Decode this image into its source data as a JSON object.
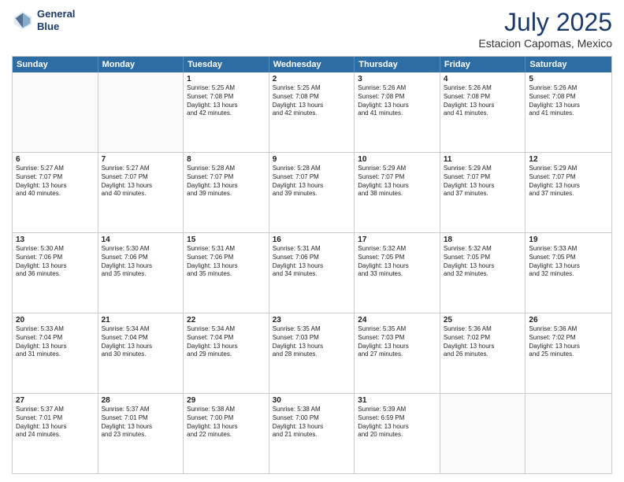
{
  "header": {
    "logo_line1": "General",
    "logo_line2": "Blue",
    "month_year": "July 2025",
    "location": "Estacion Capomas, Mexico"
  },
  "weekdays": [
    "Sunday",
    "Monday",
    "Tuesday",
    "Wednesday",
    "Thursday",
    "Friday",
    "Saturday"
  ],
  "rows": [
    [
      {
        "day": "",
        "text": ""
      },
      {
        "day": "",
        "text": ""
      },
      {
        "day": "1",
        "text": "Sunrise: 5:25 AM\nSunset: 7:08 PM\nDaylight: 13 hours\nand 42 minutes."
      },
      {
        "day": "2",
        "text": "Sunrise: 5:25 AM\nSunset: 7:08 PM\nDaylight: 13 hours\nand 42 minutes."
      },
      {
        "day": "3",
        "text": "Sunrise: 5:26 AM\nSunset: 7:08 PM\nDaylight: 13 hours\nand 41 minutes."
      },
      {
        "day": "4",
        "text": "Sunrise: 5:26 AM\nSunset: 7:08 PM\nDaylight: 13 hours\nand 41 minutes."
      },
      {
        "day": "5",
        "text": "Sunrise: 5:26 AM\nSunset: 7:08 PM\nDaylight: 13 hours\nand 41 minutes."
      }
    ],
    [
      {
        "day": "6",
        "text": "Sunrise: 5:27 AM\nSunset: 7:07 PM\nDaylight: 13 hours\nand 40 minutes."
      },
      {
        "day": "7",
        "text": "Sunrise: 5:27 AM\nSunset: 7:07 PM\nDaylight: 13 hours\nand 40 minutes."
      },
      {
        "day": "8",
        "text": "Sunrise: 5:28 AM\nSunset: 7:07 PM\nDaylight: 13 hours\nand 39 minutes."
      },
      {
        "day": "9",
        "text": "Sunrise: 5:28 AM\nSunset: 7:07 PM\nDaylight: 13 hours\nand 39 minutes."
      },
      {
        "day": "10",
        "text": "Sunrise: 5:29 AM\nSunset: 7:07 PM\nDaylight: 13 hours\nand 38 minutes."
      },
      {
        "day": "11",
        "text": "Sunrise: 5:29 AM\nSunset: 7:07 PM\nDaylight: 13 hours\nand 37 minutes."
      },
      {
        "day": "12",
        "text": "Sunrise: 5:29 AM\nSunset: 7:07 PM\nDaylight: 13 hours\nand 37 minutes."
      }
    ],
    [
      {
        "day": "13",
        "text": "Sunrise: 5:30 AM\nSunset: 7:06 PM\nDaylight: 13 hours\nand 36 minutes."
      },
      {
        "day": "14",
        "text": "Sunrise: 5:30 AM\nSunset: 7:06 PM\nDaylight: 13 hours\nand 35 minutes."
      },
      {
        "day": "15",
        "text": "Sunrise: 5:31 AM\nSunset: 7:06 PM\nDaylight: 13 hours\nand 35 minutes."
      },
      {
        "day": "16",
        "text": "Sunrise: 5:31 AM\nSunset: 7:06 PM\nDaylight: 13 hours\nand 34 minutes."
      },
      {
        "day": "17",
        "text": "Sunrise: 5:32 AM\nSunset: 7:05 PM\nDaylight: 13 hours\nand 33 minutes."
      },
      {
        "day": "18",
        "text": "Sunrise: 5:32 AM\nSunset: 7:05 PM\nDaylight: 13 hours\nand 32 minutes."
      },
      {
        "day": "19",
        "text": "Sunrise: 5:33 AM\nSunset: 7:05 PM\nDaylight: 13 hours\nand 32 minutes."
      }
    ],
    [
      {
        "day": "20",
        "text": "Sunrise: 5:33 AM\nSunset: 7:04 PM\nDaylight: 13 hours\nand 31 minutes."
      },
      {
        "day": "21",
        "text": "Sunrise: 5:34 AM\nSunset: 7:04 PM\nDaylight: 13 hours\nand 30 minutes."
      },
      {
        "day": "22",
        "text": "Sunrise: 5:34 AM\nSunset: 7:04 PM\nDaylight: 13 hours\nand 29 minutes."
      },
      {
        "day": "23",
        "text": "Sunrise: 5:35 AM\nSunset: 7:03 PM\nDaylight: 13 hours\nand 28 minutes."
      },
      {
        "day": "24",
        "text": "Sunrise: 5:35 AM\nSunset: 7:03 PM\nDaylight: 13 hours\nand 27 minutes."
      },
      {
        "day": "25",
        "text": "Sunrise: 5:36 AM\nSunset: 7:02 PM\nDaylight: 13 hours\nand 26 minutes."
      },
      {
        "day": "26",
        "text": "Sunrise: 5:36 AM\nSunset: 7:02 PM\nDaylight: 13 hours\nand 25 minutes."
      }
    ],
    [
      {
        "day": "27",
        "text": "Sunrise: 5:37 AM\nSunset: 7:01 PM\nDaylight: 13 hours\nand 24 minutes."
      },
      {
        "day": "28",
        "text": "Sunrise: 5:37 AM\nSunset: 7:01 PM\nDaylight: 13 hours\nand 23 minutes."
      },
      {
        "day": "29",
        "text": "Sunrise: 5:38 AM\nSunset: 7:00 PM\nDaylight: 13 hours\nand 22 minutes."
      },
      {
        "day": "30",
        "text": "Sunrise: 5:38 AM\nSunset: 7:00 PM\nDaylight: 13 hours\nand 21 minutes."
      },
      {
        "day": "31",
        "text": "Sunrise: 5:39 AM\nSunset: 6:59 PM\nDaylight: 13 hours\nand 20 minutes."
      },
      {
        "day": "",
        "text": ""
      },
      {
        "day": "",
        "text": ""
      }
    ]
  ]
}
